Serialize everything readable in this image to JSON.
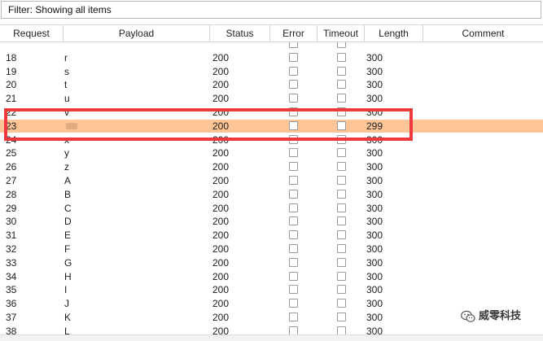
{
  "filter": {
    "label": "Filter: Showing all items"
  },
  "table": {
    "columns": [
      {
        "key": "request",
        "label": "Request"
      },
      {
        "key": "payload",
        "label": "Payload"
      },
      {
        "key": "status",
        "label": "Status"
      },
      {
        "key": "error",
        "label": "Error"
      },
      {
        "key": "timeout",
        "label": "Timeout"
      },
      {
        "key": "length",
        "label": "Length"
      },
      {
        "key": "comment",
        "label": "Comment"
      }
    ],
    "rows": [
      {
        "request": "",
        "payload": "",
        "status": "",
        "error": false,
        "timeout": false,
        "length": "",
        "partial": true
      },
      {
        "request": "18",
        "payload": "r",
        "status": "200",
        "error": false,
        "timeout": false,
        "length": "300"
      },
      {
        "request": "19",
        "payload": "s",
        "status": "200",
        "error": false,
        "timeout": false,
        "length": "300"
      },
      {
        "request": "20",
        "payload": "t",
        "status": "200",
        "error": false,
        "timeout": false,
        "length": "300"
      },
      {
        "request": "21",
        "payload": "u",
        "status": "200",
        "error": false,
        "timeout": false,
        "length": "300"
      },
      {
        "request": "22",
        "payload": "v",
        "status": "200",
        "error": false,
        "timeout": false,
        "length": "300",
        "partial": true
      },
      {
        "request": "23",
        "payload": "",
        "status": "200",
        "error": false,
        "timeout": false,
        "length": "299",
        "selected": true,
        "payload_redacted": true
      },
      {
        "request": "24",
        "payload": "x",
        "status": "200",
        "error": false,
        "timeout": false,
        "length": "300",
        "partial": true
      },
      {
        "request": "25",
        "payload": "y",
        "status": "200",
        "error": false,
        "timeout": false,
        "length": "300"
      },
      {
        "request": "26",
        "payload": "z",
        "status": "200",
        "error": false,
        "timeout": false,
        "length": "300"
      },
      {
        "request": "27",
        "payload": "A",
        "status": "200",
        "error": false,
        "timeout": false,
        "length": "300"
      },
      {
        "request": "28",
        "payload": "B",
        "status": "200",
        "error": false,
        "timeout": false,
        "length": "300"
      },
      {
        "request": "29",
        "payload": "C",
        "status": "200",
        "error": false,
        "timeout": false,
        "length": "300"
      },
      {
        "request": "30",
        "payload": "D",
        "status": "200",
        "error": false,
        "timeout": false,
        "length": "300"
      },
      {
        "request": "31",
        "payload": "E",
        "status": "200",
        "error": false,
        "timeout": false,
        "length": "300"
      },
      {
        "request": "32",
        "payload": "F",
        "status": "200",
        "error": false,
        "timeout": false,
        "length": "300"
      },
      {
        "request": "33",
        "payload": "G",
        "status": "200",
        "error": false,
        "timeout": false,
        "length": "300"
      },
      {
        "request": "34",
        "payload": "H",
        "status": "200",
        "error": false,
        "timeout": false,
        "length": "300"
      },
      {
        "request": "35",
        "payload": "I",
        "status": "200",
        "error": false,
        "timeout": false,
        "length": "300"
      },
      {
        "request": "36",
        "payload": "J",
        "status": "200",
        "error": false,
        "timeout": false,
        "length": "300"
      },
      {
        "request": "37",
        "payload": "K",
        "status": "200",
        "error": false,
        "timeout": false,
        "length": "300"
      },
      {
        "request": "38",
        "payload": "L",
        "status": "200",
        "error": false,
        "timeout": false,
        "length": "300"
      },
      {
        "request": "",
        "payload": "",
        "status": "",
        "error": false,
        "timeout": false,
        "length": "",
        "partial": true
      }
    ]
  },
  "watermark": {
    "text": "威零科技",
    "icon": "wechat-icon"
  },
  "colors": {
    "selected_row": "#ffc596",
    "highlight_box": "#ee3a3c"
  }
}
